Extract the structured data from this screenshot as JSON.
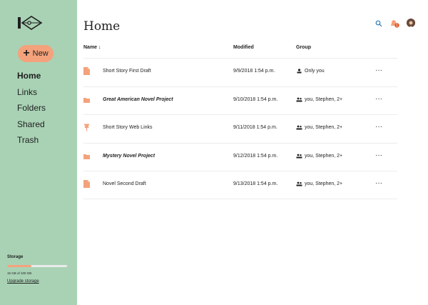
{
  "sidebar": {
    "new_label": "New",
    "nav": [
      "Home",
      "Links",
      "Folders",
      "Shared",
      "Trash"
    ],
    "active": 0,
    "storage_title": "Storage",
    "storage_text": "15 GB of 100 GB",
    "storage_used_fraction": 0.4,
    "upgrade_label": "Upgrade storage"
  },
  "header": {
    "title": "Home"
  },
  "table": {
    "columns": {
      "name": "Name ↓",
      "modified": "Modified",
      "group": "Group"
    },
    "rows": [
      {
        "name": "Short Story First Draft",
        "type": "file",
        "modified": "9/9/2018 1:54 p.m.",
        "group": "Only you",
        "group_icon": "person-icon",
        "menu": "···"
      },
      {
        "name": "Great American Novel Project",
        "type": "folder",
        "modified": "9/10/2018 1:54 p.m.",
        "group": "you, Stephen, 2+",
        "group_icon": "people-icon",
        "menu": "···"
      },
      {
        "name": "Short Story Web Links",
        "type": "link",
        "modified": "9/11/2018 1:54 p.m.",
        "group": "you, Stephen, 2+",
        "group_icon": "people-icon",
        "menu": "···"
      },
      {
        "name": "Mystery Novel Project",
        "type": "folder",
        "modified": "9/12/2018 1:54 p.m.",
        "group": "you, Stephen, 2+",
        "group_icon": "people-icon",
        "menu": "···"
      },
      {
        "name": "Novel Second Draft",
        "type": "file",
        "modified": "9/13/2018 1:54 p.m.",
        "group": "you, Stephen, 2+",
        "group_icon": "people-icon",
        "menu": "···"
      }
    ]
  },
  "notifications": {
    "count": "1"
  },
  "colors": {
    "sidebar": "#a9d2b5",
    "accent": "#f4a27b",
    "badge": "#e05a2b"
  }
}
